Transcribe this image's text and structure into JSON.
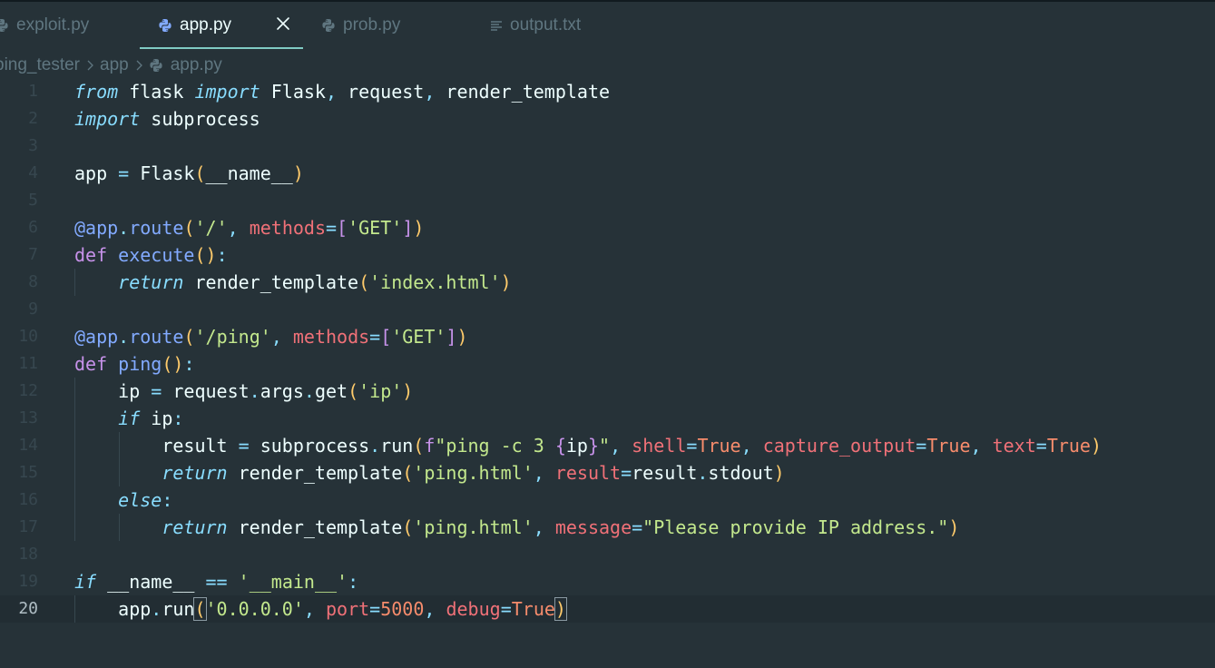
{
  "colors": {
    "background": "#263238",
    "accent": "#80cbc4",
    "keyword": "#c792ea",
    "string": "#c3e88d",
    "function": "#82aaff",
    "bracket": "#ffcb6b",
    "argument": "#f07178",
    "number": "#f78c6c"
  },
  "tabs": [
    {
      "label": "exploit.py",
      "icon": "python-icon",
      "active": false
    },
    {
      "label": "app.py",
      "icon": "python-icon",
      "active": true,
      "closable": true
    },
    {
      "label": "prob.py",
      "icon": "python-icon",
      "active": false
    },
    {
      "label": "output.txt",
      "icon": "text-file-icon",
      "active": false
    }
  ],
  "breadcrumb": [
    "ping_tester",
    "app",
    "app.py"
  ],
  "editor": {
    "current_line": 20,
    "line_numbers": [
      "1",
      "2",
      "3",
      "4",
      "5",
      "6",
      "7",
      "8",
      "9",
      "10",
      "11",
      "12",
      "13",
      "14",
      "15",
      "16",
      "17",
      "18",
      "19",
      "20"
    ],
    "lines": [
      [
        [
          "kwi",
          "from"
        ],
        [
          "plain",
          " flask "
        ],
        [
          "kwi",
          "import"
        ],
        [
          "plain",
          " Flask"
        ],
        [
          "pun",
          ","
        ],
        [
          "plain",
          " request"
        ],
        [
          "pun",
          ","
        ],
        [
          "plain",
          " render_template"
        ]
      ],
      [
        [
          "kwi",
          "import"
        ],
        [
          "plain",
          " subprocess"
        ]
      ],
      [],
      [
        [
          "plain",
          "app "
        ],
        [
          "pun",
          "="
        ],
        [
          "plain",
          " Flask"
        ],
        [
          "par",
          "("
        ],
        [
          "plain",
          "__name__"
        ],
        [
          "par",
          ")"
        ]
      ],
      [],
      [
        [
          "fn",
          "@app"
        ],
        [
          "pun",
          "."
        ],
        [
          "fn",
          "route"
        ],
        [
          "par",
          "("
        ],
        [
          "str",
          "'/'"
        ],
        [
          "pun",
          ","
        ],
        [
          "plain",
          " "
        ],
        [
          "arg",
          "methods"
        ],
        [
          "pun",
          "="
        ],
        [
          "kw",
          "["
        ],
        [
          "str",
          "'GET'"
        ],
        [
          "kw",
          "]"
        ],
        [
          "par",
          ")"
        ]
      ],
      [
        [
          "kw",
          "def"
        ],
        [
          "plain",
          " "
        ],
        [
          "fn",
          "execute"
        ],
        [
          "par",
          "()"
        ],
        [
          "pun",
          ":"
        ]
      ],
      [
        [
          "plain",
          "    "
        ],
        [
          "kwi",
          "return"
        ],
        [
          "plain",
          " render_template"
        ],
        [
          "par",
          "("
        ],
        [
          "str",
          "'index.html'"
        ],
        [
          "par",
          ")"
        ]
      ],
      [],
      [
        [
          "fn",
          "@app"
        ],
        [
          "pun",
          "."
        ],
        [
          "fn",
          "route"
        ],
        [
          "par",
          "("
        ],
        [
          "str",
          "'/ping'"
        ],
        [
          "pun",
          ","
        ],
        [
          "plain",
          " "
        ],
        [
          "arg",
          "methods"
        ],
        [
          "pun",
          "="
        ],
        [
          "kw",
          "["
        ],
        [
          "str",
          "'GET'"
        ],
        [
          "kw",
          "]"
        ],
        [
          "par",
          ")"
        ]
      ],
      [
        [
          "kw",
          "def"
        ],
        [
          "plain",
          " "
        ],
        [
          "fn",
          "ping"
        ],
        [
          "par",
          "()"
        ],
        [
          "pun",
          ":"
        ]
      ],
      [
        [
          "plain",
          "    ip "
        ],
        [
          "pun",
          "="
        ],
        [
          "plain",
          " request"
        ],
        [
          "pun",
          "."
        ],
        [
          "plain",
          "args"
        ],
        [
          "pun",
          "."
        ],
        [
          "plain",
          "get"
        ],
        [
          "par",
          "("
        ],
        [
          "str",
          "'ip'"
        ],
        [
          "par",
          ")"
        ]
      ],
      [
        [
          "plain",
          "    "
        ],
        [
          "kwi",
          "if"
        ],
        [
          "plain",
          " ip"
        ],
        [
          "pun",
          ":"
        ]
      ],
      [
        [
          "plain",
          "        result "
        ],
        [
          "pun",
          "="
        ],
        [
          "plain",
          " subprocess"
        ],
        [
          "pun",
          "."
        ],
        [
          "plain",
          "run"
        ],
        [
          "par",
          "("
        ],
        [
          "kw",
          "f"
        ],
        [
          "str",
          "\"ping -c 3 "
        ],
        [
          "kw",
          "{"
        ],
        [
          "plain",
          "ip"
        ],
        [
          "kw",
          "}"
        ],
        [
          "str",
          "\""
        ],
        [
          "pun",
          ","
        ],
        [
          "plain",
          " "
        ],
        [
          "arg",
          "shell"
        ],
        [
          "pun",
          "="
        ],
        [
          "num",
          "True"
        ],
        [
          "pun",
          ","
        ],
        [
          "plain",
          " "
        ],
        [
          "arg",
          "capture_output"
        ],
        [
          "pun",
          "="
        ],
        [
          "num",
          "True"
        ],
        [
          "pun",
          ","
        ],
        [
          "plain",
          " "
        ],
        [
          "arg",
          "text"
        ],
        [
          "pun",
          "="
        ],
        [
          "num",
          "True"
        ],
        [
          "par",
          ")"
        ]
      ],
      [
        [
          "plain",
          "        "
        ],
        [
          "kwi",
          "return"
        ],
        [
          "plain",
          " render_template"
        ],
        [
          "par",
          "("
        ],
        [
          "str",
          "'ping.html'"
        ],
        [
          "pun",
          ","
        ],
        [
          "plain",
          " "
        ],
        [
          "arg",
          "result"
        ],
        [
          "pun",
          "="
        ],
        [
          "plain",
          "result"
        ],
        [
          "pun",
          "."
        ],
        [
          "plain",
          "stdout"
        ],
        [
          "par",
          ")"
        ]
      ],
      [
        [
          "plain",
          "    "
        ],
        [
          "kwi",
          "else"
        ],
        [
          "pun",
          ":"
        ]
      ],
      [
        [
          "plain",
          "        "
        ],
        [
          "kwi",
          "return"
        ],
        [
          "plain",
          " render_template"
        ],
        [
          "par",
          "("
        ],
        [
          "str",
          "'ping.html'"
        ],
        [
          "pun",
          ","
        ],
        [
          "plain",
          " "
        ],
        [
          "arg",
          "message"
        ],
        [
          "pun",
          "="
        ],
        [
          "str",
          "\"Please provide IP address.\""
        ],
        [
          "par",
          ")"
        ]
      ],
      [],
      [
        [
          "kwi",
          "if"
        ],
        [
          "plain",
          " __name__ "
        ],
        [
          "pun",
          "=="
        ],
        [
          "plain",
          " "
        ],
        [
          "str",
          "'__main__'"
        ],
        [
          "pun",
          ":"
        ]
      ],
      [
        [
          "plain",
          "    app"
        ],
        [
          "pun",
          "."
        ],
        [
          "plain",
          "run"
        ],
        [
          "par",
          "("
        ],
        [
          "str",
          "'0.0.0.0'"
        ],
        [
          "pun",
          ","
        ],
        [
          "plain",
          " "
        ],
        [
          "arg",
          "port"
        ],
        [
          "pun",
          "="
        ],
        [
          "num",
          "5000"
        ],
        [
          "pun",
          ","
        ],
        [
          "plain",
          " "
        ],
        [
          "arg",
          "debug"
        ],
        [
          "pun",
          "="
        ],
        [
          "num",
          "True"
        ],
        [
          "par",
          ")"
        ]
      ]
    ]
  }
}
